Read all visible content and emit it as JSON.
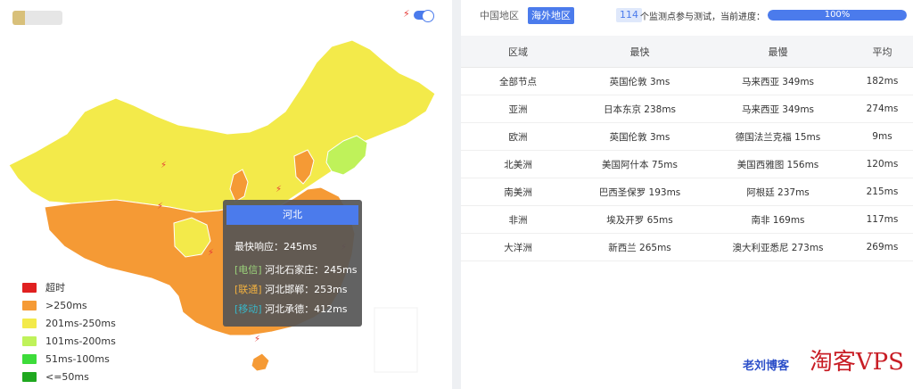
{
  "map": {
    "colors": {
      "timeout": "#e02020",
      "gt250": "#f59a35",
      "r201_250": "#f3ea4a",
      "r101_200": "#bff25a",
      "r51_100": "#3ddc3a",
      "le50": "#1fa81f"
    },
    "legend": [
      {
        "label": "超时",
        "color": "#e02020"
      },
      {
        "label": ">250ms",
        "color": "#f59a35"
      },
      {
        "label": "201ms-250ms",
        "color": "#f3ea4a"
      },
      {
        "label": "101ms-200ms",
        "color": "#bff25a"
      },
      {
        "label": "51ms-100ms",
        "color": "#3ddc3a"
      },
      {
        "label": "<=50ms",
        "color": "#1fa81f"
      }
    ],
    "tooltip": {
      "title": "河北",
      "fastest": "最快响应：245ms",
      "line1_isp": "[电信]",
      "line1_text": " 河北石家庄：245ms",
      "line2_isp": "[联通]",
      "line2_text": " 河北邯郸：253ms",
      "line3_isp": "[移动]",
      "line3_text": " 河北承德：412ms"
    },
    "icons": {
      "bolt": "⚡",
      "toggle": "toggle-switch"
    }
  },
  "tabs": [
    {
      "label": "中国地区",
      "active": false
    },
    {
      "label": "海外地区",
      "active": true
    }
  ],
  "progress": {
    "count": "114",
    "label": "个监测点参与测试，当前进度：",
    "percent": 100,
    "text": "100%"
  },
  "table": {
    "headers": [
      "区域",
      "最快",
      "最慢",
      "平均"
    ],
    "rows": [
      [
        "全部节点",
        "英国伦敦 3ms",
        "马来西亚 349ms",
        "182ms"
      ],
      [
        "亚洲",
        "日本东京 238ms",
        "马来西亚 349ms",
        "274ms"
      ],
      [
        "欧洲",
        "英国伦敦 3ms",
        "德国法兰克福 15ms",
        "9ms"
      ],
      [
        "北美洲",
        "美国阿什本 75ms",
        "美国西雅图 156ms",
        "120ms"
      ],
      [
        "南美洲",
        "巴西圣保罗 193ms",
        "阿根廷 237ms",
        "215ms"
      ],
      [
        "非洲",
        "埃及开罗 65ms",
        "南非 169ms",
        "117ms"
      ],
      [
        "大洋洲",
        "新西兰 265ms",
        "澳大利亚悉尼 273ms",
        "269ms"
      ]
    ]
  },
  "watermark": {
    "blog": "老刘博客",
    "brand": "淘客VPS"
  }
}
